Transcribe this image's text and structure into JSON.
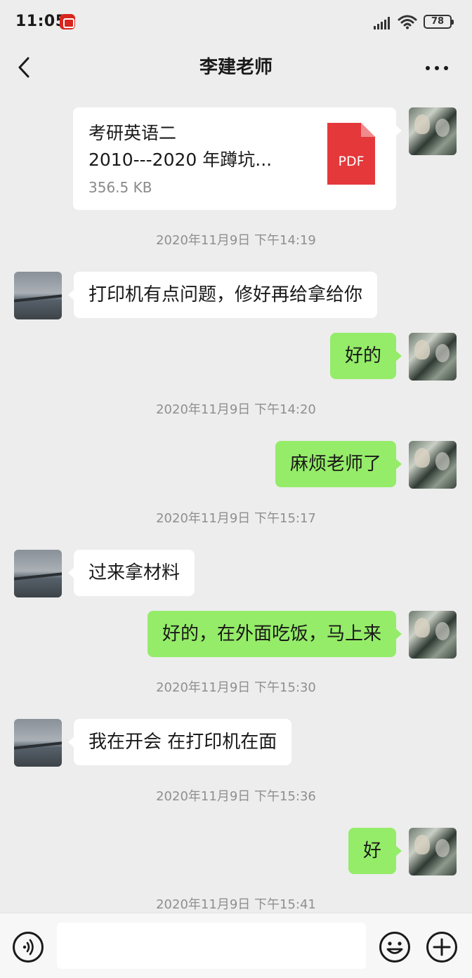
{
  "status_bar": {
    "time": "11:05",
    "battery": "78",
    "icons": [
      "app-badge-icon",
      "signal-icon",
      "wifi-icon",
      "battery-icon"
    ]
  },
  "header": {
    "title": "李建老师",
    "back_icon": "chevron-left-icon",
    "more_icon": "more-dots-icon"
  },
  "file_message": {
    "name_line1": "考研英语二",
    "name_line2": "2010---2020 年蹲坑...",
    "size": "356.5 KB",
    "file_icon_label": "PDF"
  },
  "messages": [
    {
      "type": "time",
      "text": "2020年11月9日 下午14:19"
    },
    {
      "type": "in",
      "text": "打印机有点问题，修好再给拿给你"
    },
    {
      "type": "out",
      "text": "好的"
    },
    {
      "type": "time",
      "text": "2020年11月9日 下午14:20"
    },
    {
      "type": "out",
      "text": "麻烦老师了"
    },
    {
      "type": "time",
      "text": "2020年11月9日 下午15:17"
    },
    {
      "type": "in",
      "text": "过来拿材料"
    },
    {
      "type": "out",
      "text": "好的，在外面吃饭，马上来"
    },
    {
      "type": "time",
      "text": "2020年11月9日 下午15:30"
    },
    {
      "type": "in",
      "text": "我在开会 在打印机在面"
    },
    {
      "type": "time",
      "text": "2020年11月9日 下午15:36"
    },
    {
      "type": "out",
      "text": "好"
    },
    {
      "type": "time",
      "text": "2020年11月9日 下午15:41"
    }
  ],
  "input_bar": {
    "placeholder": "",
    "icons": [
      "voice-icon",
      "emoji-icon",
      "plus-icon"
    ]
  },
  "colors": {
    "background": "#ededed",
    "outgoing_bubble": "#95ec69",
    "incoming_bubble": "#ffffff",
    "pdf_red": "#e5383b",
    "timestamp": "#8f8f8f"
  }
}
